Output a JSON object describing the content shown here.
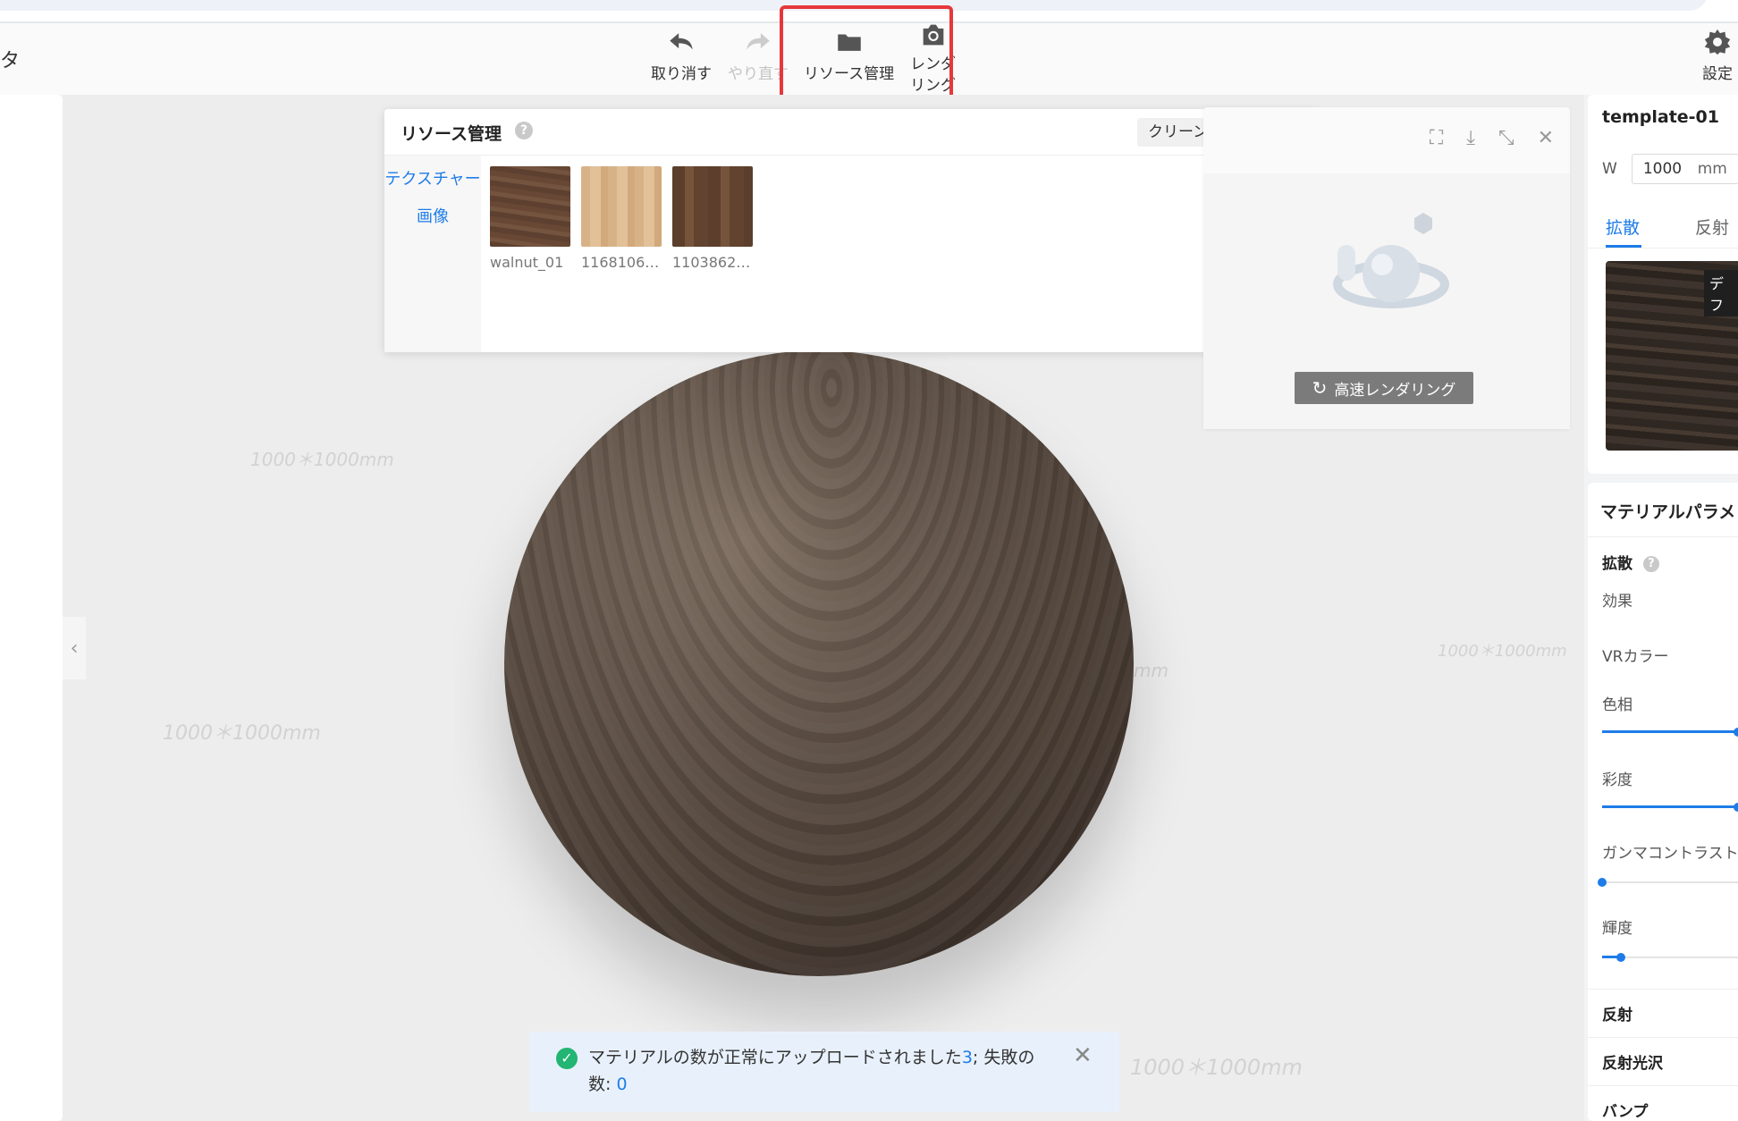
{
  "toolbar": {
    "left_title": "タ",
    "undo_label": "取り消す",
    "redo_label": "やり直す",
    "resource_label": "リソース管理",
    "render_label_line1": "レンダ",
    "render_label_line2": "リング",
    "settings_label": "設定"
  },
  "canvas": {
    "grid_label": "1000＊1000mm",
    "grid_label_partial": "mm"
  },
  "resource_panel": {
    "title": "リソース管理",
    "help": "?",
    "cleanup_label": "クリーンアップ",
    "close": "✕",
    "side_tabs": [
      "テクスチャー",
      "画像"
    ],
    "textures": [
      {
        "name": "walnut_01",
        "color": "#6b4a37"
      },
      {
        "name": "1168106…",
        "color": "#d9b48a"
      },
      {
        "name": "1103862…",
        "color": "#6a4a36"
      }
    ]
  },
  "preview": {
    "fast_render_label": "高速レンダリング"
  },
  "right_panel": {
    "template_name": "template-01",
    "w_label": "W",
    "w_value": "1000",
    "w_unit": "mm",
    "tab_diffuse": "拡散",
    "tab_reflect": "反射",
    "default_tag": "デフ",
    "material_params_title": "マテリアルパラメ",
    "diffuse_section": "拡散",
    "effect_label": "効果",
    "vr_color_label": "VRカラー",
    "hue_label": "色相",
    "hue_value": 1.0,
    "saturation_label": "彩度",
    "saturation_value": 1.0,
    "gamma_label": "ガンマコントラスト",
    "gamma_value": 0.0,
    "brightness_label": "輝度",
    "brightness_value": 0.14,
    "sections": [
      "反射",
      "反射光沢",
      "バンプ"
    ]
  },
  "toast": {
    "msg_part1": "マテリアルの数が正常にアップロードされました",
    "success_count": "3",
    "msg_part2": "; 失敗の数: ",
    "fail_count": "0"
  },
  "colors": {
    "accent": "#1e7ce8",
    "highlight": "#e6373a",
    "success": "#22b573"
  }
}
